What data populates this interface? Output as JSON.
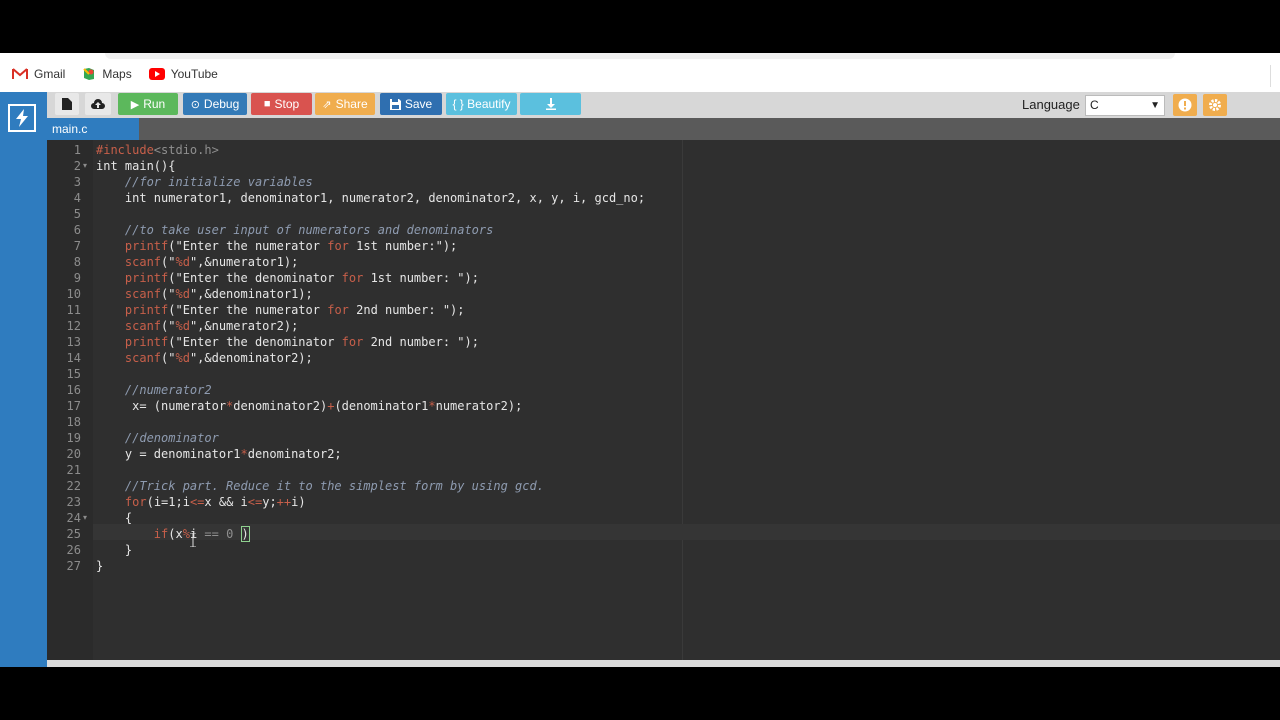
{
  "bookmarks": [
    {
      "label": "Gmail",
      "icon": "gmail-icon"
    },
    {
      "label": "Maps",
      "icon": "maps-icon"
    },
    {
      "label": "YouTube",
      "icon": "youtube-icon"
    }
  ],
  "toolbar": {
    "new_file_icon": "file-icon",
    "upload_icon": "upload-icon",
    "run_label": "Run",
    "debug_label": "Debug",
    "stop_label": "Stop",
    "share_label": "Share",
    "save_label": "Save",
    "beautify_label": "{ } Beautify",
    "download_icon": "download-icon",
    "language_label": "Language",
    "language_value": "C"
  },
  "colors": {
    "run": "#5cb85c",
    "debug": "#337ab7",
    "stop": "#d9534f",
    "share": "#f0ad4e",
    "save": "#2f6fb0",
    "beautify": "#5bc0de",
    "download": "#5bc0de",
    "sidebar": "#2f7cbf",
    "editor_bg": "#2f2f2f"
  },
  "tabs": [
    {
      "label": "main.c"
    }
  ],
  "code_lines": [
    "#include<stdio.h>",
    "int main(){",
    "    //for initialize variables",
    "    int numerator1, denominator1, numerator2, denominator2, x, y, i, gcd_no;",
    "",
    "    //to take user input of numerators and denominators",
    "    printf(\"Enter the numerator for 1st number:\");",
    "    scanf(\"%d\",&numerator1);",
    "    printf(\"Enter the denominator for 1st number: \");",
    "    scanf(\"%d\",&denominator1);",
    "    printf(\"Enter the numerator for 2nd number: \");",
    "    scanf(\"%d\",&numerator2);",
    "    printf(\"Enter the denominator for 2nd number: \");",
    "    scanf(\"%d\",&denominator2);",
    "",
    "    //numerator2",
    "     x= (numerator*denominator2)+(denominator1*numerator2);",
    "",
    "    //denominator",
    "    y = denominator1*denominator2;",
    "",
    "    //Trick part. Reduce it to the simplest form by using gcd.",
    "    for(i=1;i<=x && i<=y;++i)",
    "    {",
    "        if(x%i == 0 )",
    "    }",
    "}"
  ]
}
